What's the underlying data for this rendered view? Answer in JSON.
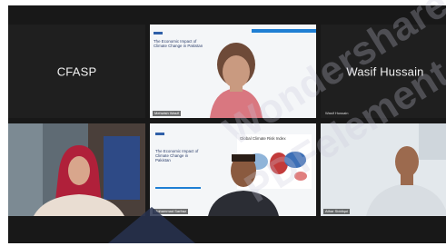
{
  "participants": [
    {
      "id": "cfasp",
      "display_name": "CFASP"
    },
    {
      "id": "presenter",
      "name_tag": "Mehwish Wasif"
    },
    {
      "id": "wasif",
      "display_name": "Wasif Hussain",
      "name_tag": "Wasif Hussain"
    },
    {
      "id": "hijab_woman",
      "name_tag": ""
    },
    {
      "id": "shared_screen",
      "name_tag": "Mohammad Sarfraz"
    },
    {
      "id": "man_right",
      "name_tag": "Athar Siddiqui"
    }
  ],
  "slides": {
    "top_title": "The Economic Impact of Climate Change in Pakistan",
    "bottom_title": "The Economic Impact of Climate Change in Pakistan",
    "map_title": "Global Climate Risk Index"
  },
  "watermark": {
    "line1": "Wondershare",
    "line2": "PDFelement"
  },
  "colors": {
    "accent": "#1f7fd4",
    "background": "#181818"
  }
}
